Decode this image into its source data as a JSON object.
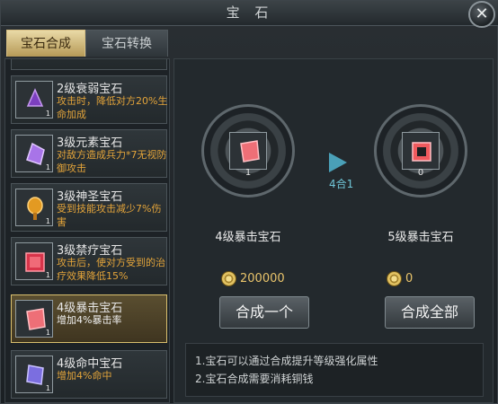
{
  "window": {
    "title": "宝 石",
    "close_label": "✕"
  },
  "tabs": [
    {
      "label": "宝石合成",
      "active": true
    },
    {
      "label": "宝石转换",
      "active": false
    }
  ],
  "gems": [
    {
      "name": "2级衰弱宝石",
      "desc": "攻击时，降低对方20%生命加成",
      "count": "1",
      "color": "#7c3fbf",
      "icon": "purple-gem-icon"
    },
    {
      "name": "3级元素宝石",
      "desc": "对敌方造成兵力*7无视防御攻击",
      "count": "1",
      "color": "#a874e8",
      "icon": "lilac-gem-icon"
    },
    {
      "name": "3级神圣宝石",
      "desc": "受到技能攻击减少7%伤害",
      "count": "1",
      "color": "#e39a22",
      "icon": "gold-gem-icon"
    },
    {
      "name": "3级禁疗宝石",
      "desc": "攻击后，使对方受到的治疗效果降低15%",
      "count": "1",
      "color": "#d8344a",
      "icon": "red-gem-icon"
    },
    {
      "name": "4级暴击宝石",
      "desc": "增加4%暴击率",
      "count": "1",
      "color": "#ee6f77",
      "icon": "pink-gem-icon",
      "selected": true
    },
    {
      "name": "4级命中宝石",
      "desc": "增加4%命中",
      "count": "1",
      "color": "#7b6ee0",
      "icon": "violet-gem-icon"
    }
  ],
  "synth": {
    "source": {
      "name": "4级暴击宝石",
      "count": "1",
      "color": "#ee6f77"
    },
    "target": {
      "name": "5级暴击宝石",
      "count": "0",
      "color": "#ee5a5e"
    },
    "ratio": "4合1",
    "cost_one": "200000",
    "cost_all": "0",
    "btn_one": "合成一个",
    "btn_all": "合成全部",
    "info": [
      "1.宝石可以通过合成提升等级强化属性",
      "2.宝石合成需要消耗铜钱"
    ]
  }
}
